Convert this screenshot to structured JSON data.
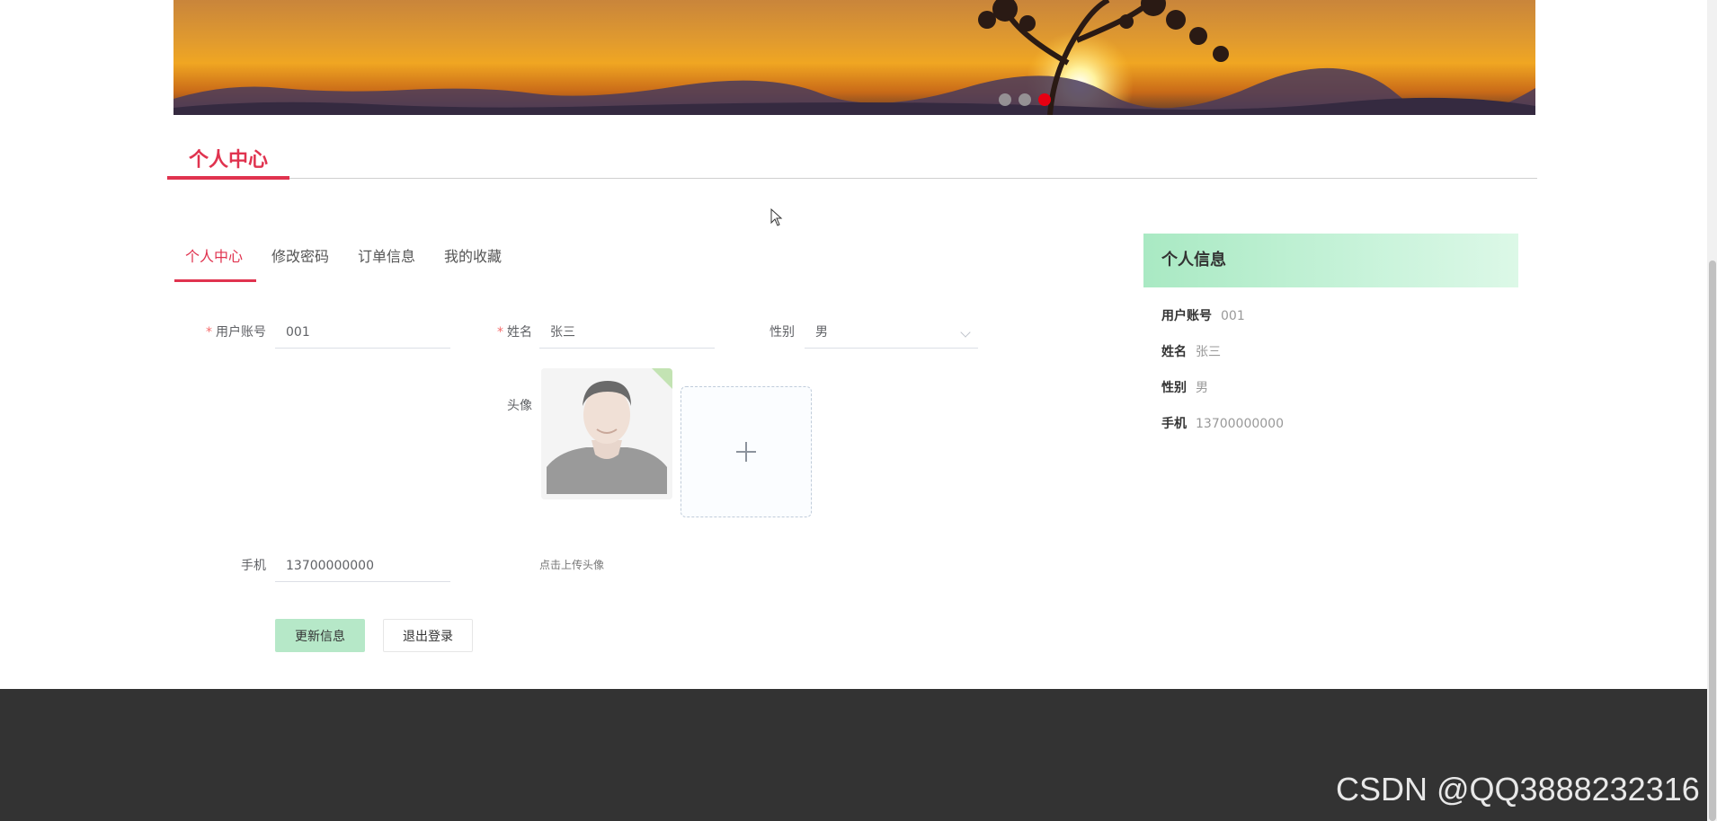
{
  "banner": {
    "slides": 3,
    "active_slide": 3
  },
  "section": {
    "title": "个人中心"
  },
  "tabs": [
    {
      "label": "个人中心",
      "active": true
    },
    {
      "label": "修改密码",
      "active": false
    },
    {
      "label": "订单信息",
      "active": false
    },
    {
      "label": "我的收藏",
      "active": false
    }
  ],
  "form": {
    "account": {
      "label": "用户账号",
      "value": "001",
      "required_mark": "*"
    },
    "name": {
      "label": "姓名",
      "value": "张三",
      "required_mark": "*"
    },
    "gender": {
      "label": "性别",
      "value": "男"
    },
    "avatar": {
      "label": "头像",
      "tip": "点击上传头像"
    },
    "phone": {
      "label": "手机",
      "value": "13700000000"
    },
    "update_button": "更新信息",
    "logout_button": "退出登录"
  },
  "info": {
    "title": "个人信息",
    "rows": [
      {
        "key": "用户账号",
        "value": "001"
      },
      {
        "key": "姓名",
        "value": "张三"
      },
      {
        "key": "性别",
        "value": "男"
      },
      {
        "key": "手机",
        "value": "13700000000"
      }
    ]
  },
  "watermark": "CSDN @QQ3888232316",
  "colors": {
    "accent": "#e0334f",
    "primary_button": "#b6e8c8",
    "footer": "#333333",
    "active_dot": "#e60012"
  }
}
